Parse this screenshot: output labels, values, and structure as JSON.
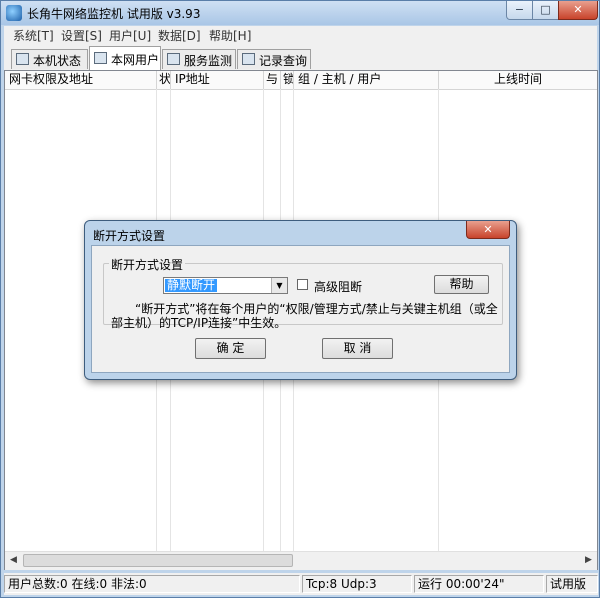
{
  "window": {
    "title": "长角牛网络监控机 试用版 v3.93",
    "min_symbol": "−",
    "max_symbol": "□",
    "close_symbol": "✕"
  },
  "menu": [
    "系统[T]",
    "设置[S]",
    "用户[U]",
    "数据[D]",
    "帮助[H]"
  ],
  "tabs": [
    {
      "label": "本机状态",
      "active": false
    },
    {
      "label": "本网用户",
      "active": true
    },
    {
      "label": "服务监测",
      "active": false
    },
    {
      "label": "记录查询",
      "active": false
    }
  ],
  "columns": [
    "网卡权限及地址",
    "状",
    "IP地址",
    "与",
    "锁",
    "组 / 主机 / 用户",
    "上线时间"
  ],
  "scroll": {
    "left": "◀",
    "right": "▶"
  },
  "status": {
    "users": "用户总数:0 在线:0 非法:0",
    "ports": "Tcp:8 Udp:3",
    "runtime": "运行 00:00'24\"",
    "edition": "试用版"
  },
  "dialog": {
    "title": "断开方式设置",
    "close_symbol": "✕",
    "group_title": "断开方式设置",
    "mode_value": "静默断开",
    "arrow": "▼",
    "advanced_label": "高级阻断",
    "help_label": "帮助",
    "description": "“断开方式”将在每个用户的“权限/管理方式/禁止与关键主机组（或全部主机）的TCP/IP连接”中生效。",
    "ok_label": "确 定",
    "cancel_label": "取 消"
  }
}
